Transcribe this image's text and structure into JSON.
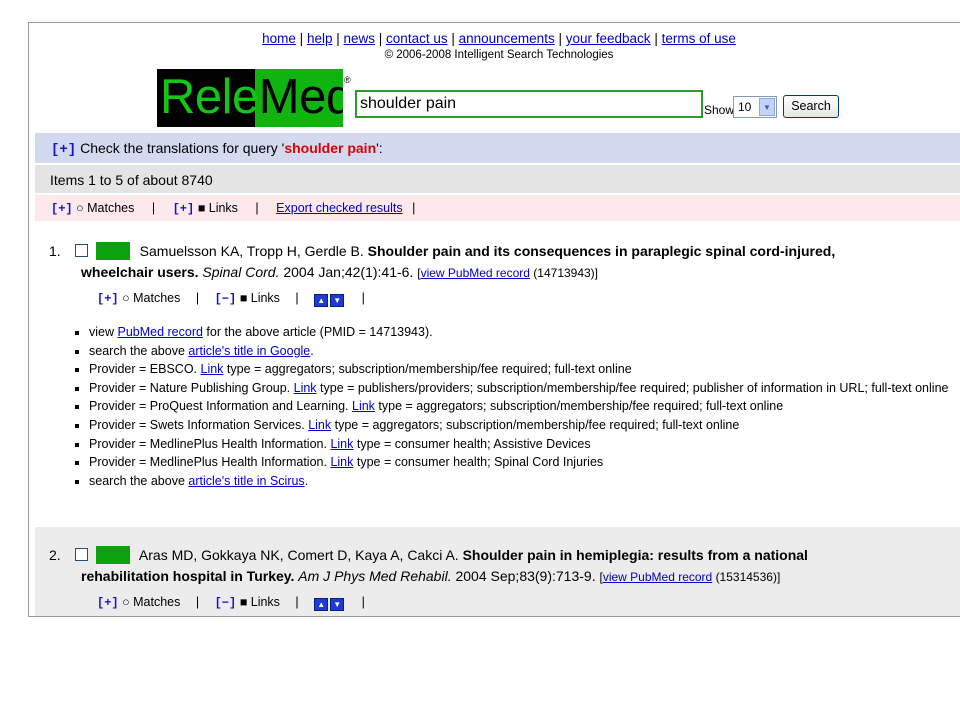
{
  "nav": {
    "links": [
      "home",
      "help",
      "news",
      "contact us",
      "announcements",
      "your feedback",
      "terms of use"
    ],
    "copyright": "© 2006-2008 Intelligent Search Technologies"
  },
  "logo": {
    "part1": "Rele",
    "part2": "Med",
    "reg": "®"
  },
  "search": {
    "value": "shoulder pain",
    "show_label": "Show",
    "show_value": "10",
    "button": "Search"
  },
  "translations": {
    "plus": "[+]",
    "text_before": "Check the translations for query '",
    "query": "shoulder pain",
    "text_after": "':"
  },
  "items_summary": "Items 1 to 5 of about 8740",
  "toolbar": {
    "matches_plus": "[+]",
    "matches_bullet": "○",
    "matches_label": "Matches",
    "sep": "|",
    "links_plus": "[+]",
    "links_bullet": "■",
    "links_label": "Links",
    "export_label": "Export checked results"
  },
  "results": [
    {
      "num": "1.",
      "authors": "Samuelsson KA, Tropp H, Gerdle B.",
      "title_line1": "Shoulder pain and its consequences in paraplegic spinal cord-injured,",
      "title_line2": "wheelchair users.",
      "journal": "Spinal Cord.",
      "citation": "2004 Jan;42(1):41-6.",
      "pubmed_link": "view PubMed record",
      "pmid": "(14713943)]",
      "sub_matches_plus": "[+]",
      "sub_matches_bullet": "○",
      "sub_matches": "Matches",
      "sub_links_minus": "[−]",
      "sub_links_bullet": "■",
      "sub_links": "Links",
      "up_icon": "▲",
      "down_icon": "▼",
      "bullets": [
        {
          "pre": "view ",
          "link": "PubMed record",
          "post": " for the above article (PMID = 14713943)."
        },
        {
          "pre": "search the above ",
          "link": "article's title in Google",
          "post": "."
        },
        {
          "pre": "Provider = EBSCO. ",
          "link": "Link",
          "post": " type = aggregators; subscription/membership/fee required; full-text online"
        },
        {
          "pre": "Provider = Nature Publishing Group. ",
          "link": "Link",
          "post": " type = publishers/providers; subscription/membership/fee required; publisher of information in URL; full-text online"
        },
        {
          "pre": "Provider = ProQuest Information and Learning. ",
          "link": "Link",
          "post": " type = aggregators; subscription/membership/fee required; full-text online"
        },
        {
          "pre": "Provider = Swets Information Services. ",
          "link": "Link",
          "post": " type = aggregators; subscription/membership/fee required; full-text online"
        },
        {
          "pre": "Provider = MedlinePlus Health Information. ",
          "link": "Link",
          "post": " type = consumer health; Assistive Devices"
        },
        {
          "pre": "Provider = MedlinePlus Health Information. ",
          "link": "Link",
          "post": " type = consumer health; Spinal Cord Injuries"
        },
        {
          "pre": "search the above ",
          "link": "article's title in Scirus",
          "post": "."
        }
      ]
    },
    {
      "num": "2.",
      "authors": "Aras MD, Gokkaya NK, Comert D, Kaya A, Cakci A.",
      "title_line1": "Shoulder pain in hemiplegia: results from a national",
      "title_line2": "rehabilitation hospital in Turkey.",
      "journal": "Am J Phys Med Rehabil.",
      "citation": "2004 Sep;83(9):713-9.",
      "pubmed_link": "view PubMed record",
      "pmid": "(15314536)]",
      "sub_matches_plus": "[+]",
      "sub_matches_bullet": "○",
      "sub_matches": "Matches",
      "sub_links_minus": "[−]",
      "sub_links_bullet": "■",
      "sub_links": "Links",
      "up_icon": "▲",
      "down_icon": "▼"
    }
  ],
  "colors": {
    "logo_green": "#0fb40f",
    "query_red": "#e00000",
    "link_blue": "#0000cc",
    "band_blue": "#d3daf0",
    "band_pink": "#fde8ec"
  }
}
